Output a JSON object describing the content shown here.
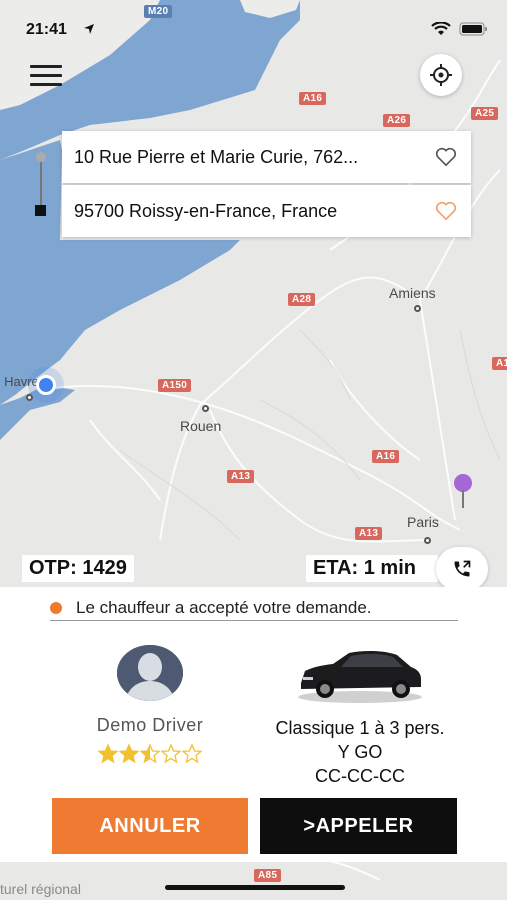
{
  "status_bar": {
    "time": "21:41",
    "icons": [
      "location-arrow-icon",
      "wifi-icon",
      "battery-icon"
    ]
  },
  "map": {
    "road_labels": [
      "M20",
      "A16",
      "A26",
      "A25",
      "A28",
      "A150",
      "A16",
      "A13",
      "A13",
      "A1",
      "A85"
    ],
    "city_labels": {
      "le_havre": "Le Havre",
      "rouen": "Rouen",
      "amiens": "Amiens",
      "paris": "Paris"
    },
    "footer_text": "turel régional",
    "colors": {
      "sea": "#7fa6d1",
      "land": "#e8e8e6",
      "road_badge": "#d8675d",
      "user_dot": "#3f82f0",
      "dest_pin": "#a566d6"
    }
  },
  "route": {
    "pickup": "10 Rue Pierre et Marie Curie, 762...",
    "dropoff": "95700 Roissy-en-France, France",
    "pickup_heart_color": "#555555",
    "dropoff_heart_color": "#f4a06a"
  },
  "trip": {
    "otp": "OTP: 1429",
    "eta": "ETA: 1 min"
  },
  "sheet": {
    "status_message": "Le chauffeur a accepté votre demande.",
    "driver": {
      "name": "Demo Driver",
      "rating": 2.5,
      "rating_max": 5
    },
    "vehicle": {
      "class": "Classique 1 à 3 pers.",
      "company": "Y GO",
      "plate": "CC-CC-CC"
    },
    "buttons": {
      "cancel": "ANNULER",
      "call": ">APPELER"
    },
    "colors": {
      "accent": "#ef7b32",
      "dark": "#0e0e0e",
      "star": "#f2c12e"
    }
  }
}
